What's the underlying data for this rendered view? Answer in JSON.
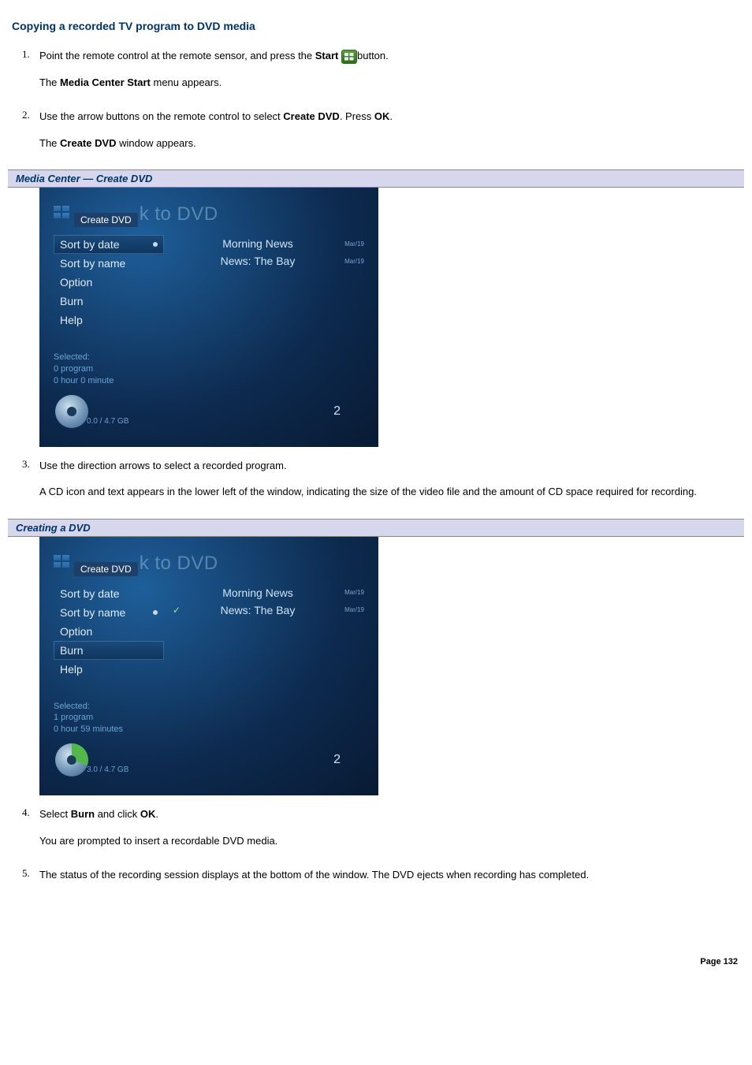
{
  "title": "Copying a recorded TV program to DVD media",
  "steps": {
    "s1": {
      "num": "1.",
      "line1a": "Point the remote control at the remote sensor, and press the ",
      "line1b": "Start",
      "line1c": "button.",
      "line2a": "The ",
      "line2b": "Media Center Start",
      "line2c": " menu appears."
    },
    "s2": {
      "num": "2.",
      "line1a": "Use the arrow buttons on the remote control to select ",
      "line1b": "Create DVD",
      "line1c": ". Press ",
      "line1d": "OK",
      "line1e": ".",
      "line2a": "The ",
      "line2b": "Create DVD",
      "line2c": " window appears."
    },
    "s3": {
      "num": "3.",
      "line1": "Use the direction arrows to select a recorded program.",
      "line2": "A CD icon and text appears in the lower left of the window, indicating the size of the video file and the amount of CD space required for recording."
    },
    "s4": {
      "num": "4.",
      "line1a": "Select ",
      "line1b": "Burn",
      "line1c": " and click ",
      "line1d": "OK",
      "line1e": ".",
      "line2": "You are prompted to insert a recordable DVD media."
    },
    "s5": {
      "num": "5.",
      "line1": "The status of the recording session displays at the bottom of the window. The DVD ejects when recording has completed."
    }
  },
  "fig1": {
    "caption": "Media Center — Create DVD",
    "breadcrumb": "Create DVD",
    "logoSuffix": "k to DVD",
    "menu": [
      "Sort by date",
      "Sort by name",
      "Option",
      "Burn",
      "Help"
    ],
    "selectedMenu": 0,
    "programs": [
      {
        "title": "Morning News",
        "date": "Mar/19",
        "checked": false
      },
      {
        "title": "News: The Bay",
        "date": "Mar/19",
        "checked": false
      }
    ],
    "status": [
      "Selected:",
      "0 program",
      "0 hour 0 minute"
    ],
    "gb": "0.0 / 4.7 GB",
    "count": "2",
    "discGreen": false
  },
  "fig2": {
    "caption": "Creating a DVD",
    "breadcrumb": "Create DVD",
    "logoSuffix": "k to DVD",
    "menu": [
      "Sort by date",
      "Sort by name",
      "Option",
      "Burn",
      "Help"
    ],
    "selectedMenu": 3,
    "dotMenu": 1,
    "programs": [
      {
        "title": "Morning News",
        "date": "Mar/19",
        "checked": false
      },
      {
        "title": "News: The Bay",
        "date": "Mar/19",
        "checked": true
      }
    ],
    "status": [
      "Selected:",
      "1 program",
      "0 hour 59 minutes"
    ],
    "gb": "3.0 / 4.7 GB",
    "count": "2",
    "discGreen": true
  },
  "pageNumber": "Page 132"
}
